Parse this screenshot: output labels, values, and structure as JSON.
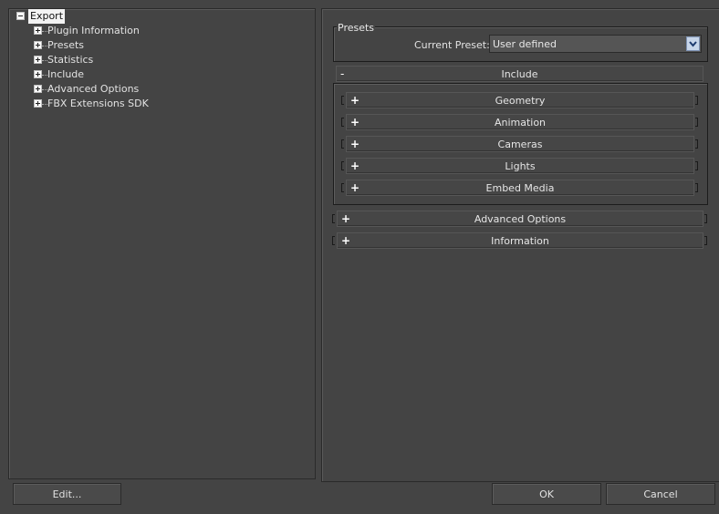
{
  "tree": {
    "root": "Export",
    "children": [
      "Plugin Information",
      "Presets",
      "Statistics",
      "Include",
      "Advanced Options",
      "FBX Extensions SDK"
    ]
  },
  "presets": {
    "group_title": "Presets",
    "current_label": "Current Preset:",
    "current_value": "User defined"
  },
  "include": {
    "label": "Include",
    "expanded_sign": "-",
    "items": [
      "Geometry",
      "Animation",
      "Cameras",
      "Lights",
      "Embed Media"
    ],
    "collapsed_sign": "+"
  },
  "sections": {
    "advanced": "Advanced Options",
    "information": "Information"
  },
  "buttons": {
    "edit": "Edit...",
    "ok": "OK",
    "cancel": "Cancel"
  }
}
